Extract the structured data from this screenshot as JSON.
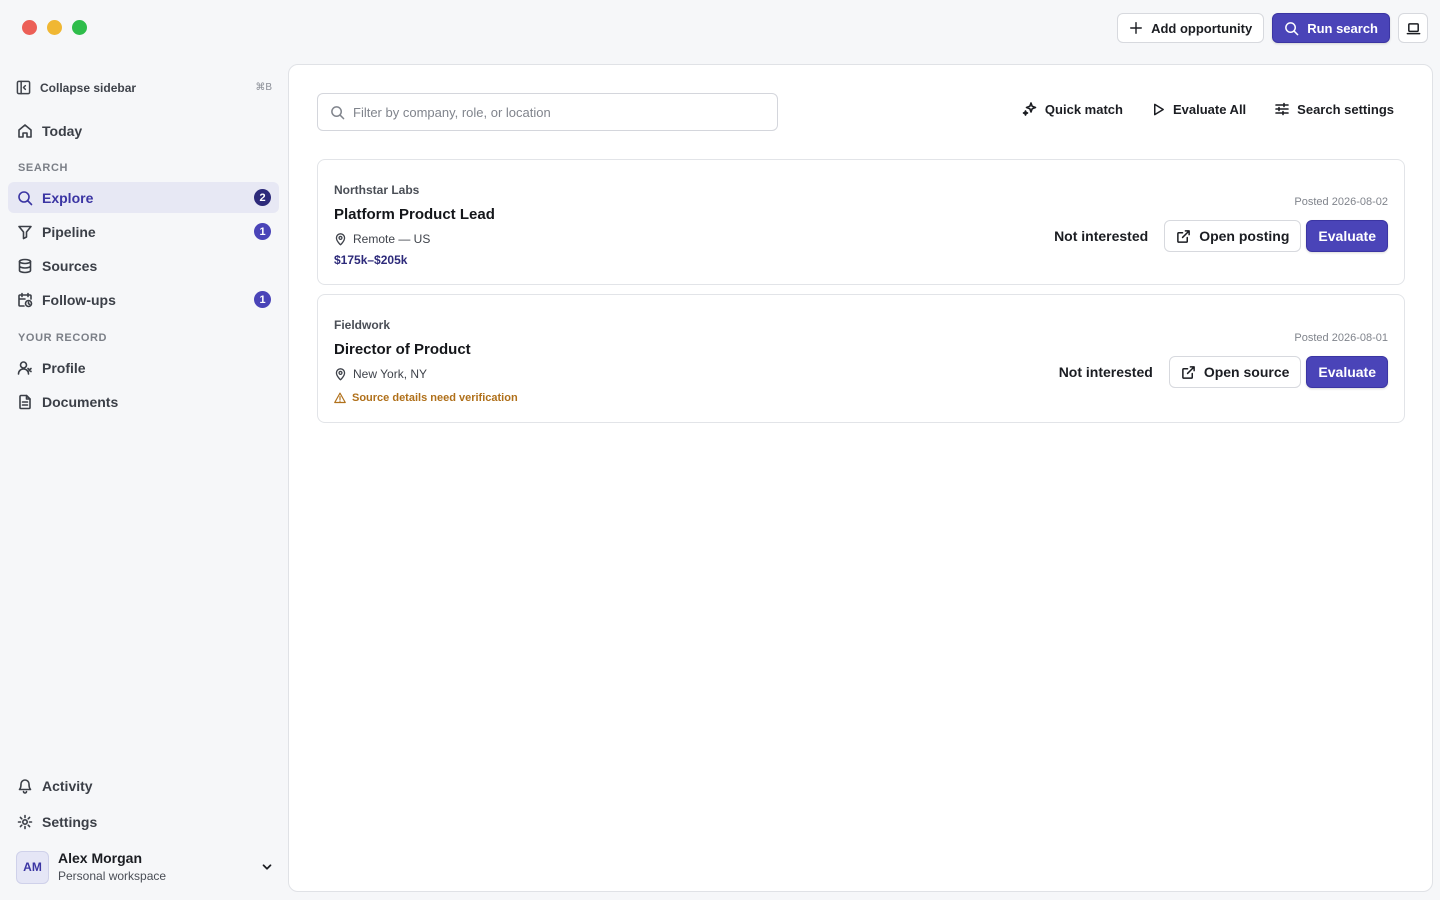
{
  "window": {
    "traffic_lights": [
      "close",
      "minimize",
      "zoom"
    ]
  },
  "topbar": {
    "add_opportunity_label": "Add opportunity",
    "run_search_label": "Run search",
    "panel_toggle_icon": "laptop-icon"
  },
  "sidebar": {
    "collapse_label": "Collapse sidebar",
    "collapse_shortcut": "⌘B",
    "today_label": "Today",
    "search_section": "SEARCH",
    "items": [
      {
        "label": "Explore",
        "badge": "2",
        "icon": "search-icon",
        "active": true
      },
      {
        "label": "Pipeline",
        "badge": "1",
        "icon": "filter-icon"
      },
      {
        "label": "Sources",
        "badge": "",
        "icon": "database-icon"
      },
      {
        "label": "Follow-ups",
        "badge": "1",
        "icon": "calendar-clock-icon"
      }
    ],
    "record_section": "YOUR RECORD",
    "record_items": [
      {
        "label": "Profile",
        "icon": "user-icon"
      },
      {
        "label": "Documents",
        "icon": "document-icon"
      }
    ],
    "activity_label": "Activity",
    "settings_label": "Settings",
    "user": {
      "initials": "AM",
      "name": "Alex Morgan",
      "workspace": "Personal workspace"
    }
  },
  "main": {
    "filter_placeholder": "Filter by company, role, or location",
    "quick_match_label": "Quick match",
    "evaluate_all_label": "Evaluate All",
    "search_settings_label": "Search settings",
    "opportunities": [
      {
        "company": "Northstar Labs",
        "role": "Platform Product Lead",
        "location": "Remote — US",
        "salary": "$175k–$205k",
        "posted": "Posted 2026-08-02",
        "dismiss_label": "Not interested",
        "open_label": "Open posting",
        "evaluate_label": "Evaluate"
      },
      {
        "company": "Fieldwork",
        "role": "Director of Product",
        "location": "New York, NY",
        "warning": "Source details need verification",
        "posted": "Posted 2026-08-01",
        "dismiss_label": "Not interested",
        "open_label": "Open source",
        "evaluate_label": "Evaluate"
      }
    ]
  },
  "colors": {
    "accent": "#4a44b8",
    "accent_dark": "#2d2a7a",
    "warning": "#b0701a"
  }
}
